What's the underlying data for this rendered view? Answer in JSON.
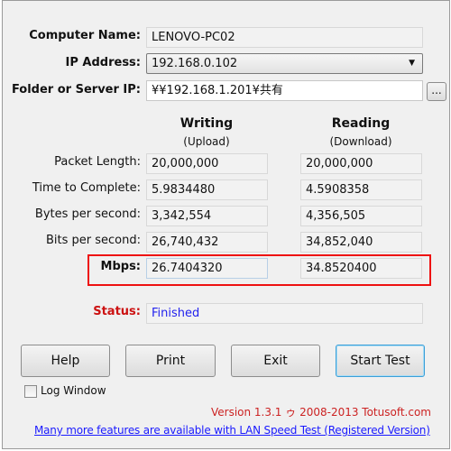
{
  "form": {
    "computer_name_label": "Computer Name:",
    "computer_name_value": "LENOVO-PC02",
    "ip_label": "IP Address:",
    "ip_value": "192.168.0.102",
    "folder_label": "Folder or Server IP:",
    "folder_value": "¥¥192.168.1.201¥共有",
    "browse_label": "..."
  },
  "columns": {
    "writing": {
      "title": "Writing",
      "sub": "(Upload)"
    },
    "reading": {
      "title": "Reading",
      "sub": "(Download)"
    }
  },
  "rows": [
    {
      "label": "Packet Length:",
      "writing": "20,000,000",
      "reading": "20,000,000"
    },
    {
      "label": "Time to Complete:",
      "writing": "5.9834480",
      "reading": "4.5908358"
    },
    {
      "label": "Bytes per second:",
      "writing": "3,342,554",
      "reading": "4,356,505"
    },
    {
      "label": "Bits per second:",
      "writing": "26,740,432",
      "reading": "34,852,040"
    },
    {
      "label": "Mbps:",
      "writing": "26.7404320",
      "reading": "34.8520400"
    }
  ],
  "status": {
    "label": "Status:",
    "value": "Finished"
  },
  "buttons": {
    "help": "Help",
    "print": "Print",
    "exit": "Exit",
    "start": "Start Test"
  },
  "log_window": {
    "label": "Log Window",
    "checked": false
  },
  "footer": {
    "version": "Version 1.3.1 ゥ 2008-2013 Totusoft.com",
    "link": "Many more features are available with LAN Speed Test (Registered Version)"
  },
  "colors": {
    "highlight_box": "#ee1111",
    "status_label": "#cc1111",
    "status_value": "#2222ee",
    "version": "#cc2222",
    "link": "#1a1aff"
  }
}
